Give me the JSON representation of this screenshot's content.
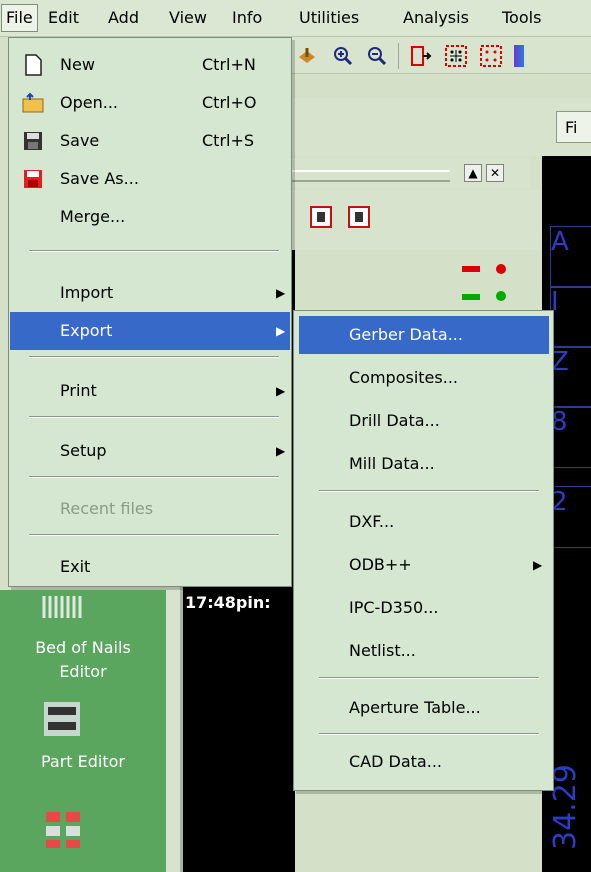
{
  "menubar": {
    "items": [
      {
        "label": "File",
        "name": "menubar-file"
      },
      {
        "label": "Edit",
        "name": "menubar-edit"
      },
      {
        "label": "Add",
        "name": "menubar-add"
      },
      {
        "label": "View",
        "name": "menubar-view"
      },
      {
        "label": "Info",
        "name": "menubar-info"
      },
      {
        "label": "Utilities",
        "name": "menubar-utilities"
      },
      {
        "label": "Analysis",
        "name": "menubar-analysis"
      },
      {
        "label": "Tools",
        "name": "menubar-tools"
      }
    ]
  },
  "file_menu": {
    "new": {
      "label": "New",
      "shortcut": "Ctrl+N",
      "icon": "new-document-icon"
    },
    "open": {
      "label": "Open...",
      "shortcut": "Ctrl+O",
      "icon": "open-folder-icon"
    },
    "save": {
      "label": "Save",
      "shortcut": "Ctrl+S",
      "icon": "save-floppy-icon"
    },
    "save_as": {
      "label": "Save As...",
      "icon": "save-as-icon"
    },
    "merge": {
      "label": "Merge..."
    },
    "import": {
      "label": "Import"
    },
    "export": {
      "label": "Export"
    },
    "print": {
      "label": "Print"
    },
    "setup": {
      "label": "Setup"
    },
    "recent": {
      "label": "Recent files"
    },
    "exit": {
      "label": "Exit"
    }
  },
  "export_submenu": {
    "gerber": {
      "label": "Gerber Data..."
    },
    "composites": {
      "label": "Composites..."
    },
    "drill": {
      "label": "Drill Data..."
    },
    "mill": {
      "label": "Mill Data..."
    },
    "dxf": {
      "label": "DXF..."
    },
    "odb": {
      "label": "ODB++"
    },
    "ipc": {
      "label": "IPC-D350..."
    },
    "netlist": {
      "label": "Netlist..."
    },
    "aperture": {
      "label": "Aperture Table..."
    },
    "cad": {
      "label": "CAD Data..."
    }
  },
  "background": {
    "fi_button": "Fi",
    "timestamp": "17:48pin:",
    "bed_of_nails": "Bed of Nails",
    "editor": "Editor",
    "part_editor": "Part Editor",
    "right_letters": [
      "A",
      "I",
      "Z",
      "8",
      "2"
    ],
    "right_rotated": "34.29",
    "panel_up": "▲",
    "panel_close": "✕"
  },
  "colors": {
    "menu_bg": "#d5e7d0",
    "highlight": "#3769c9",
    "sidebar_green": "#5aa65e",
    "viewport_dark": "#000000",
    "blue_text": "#2b3cc5"
  }
}
